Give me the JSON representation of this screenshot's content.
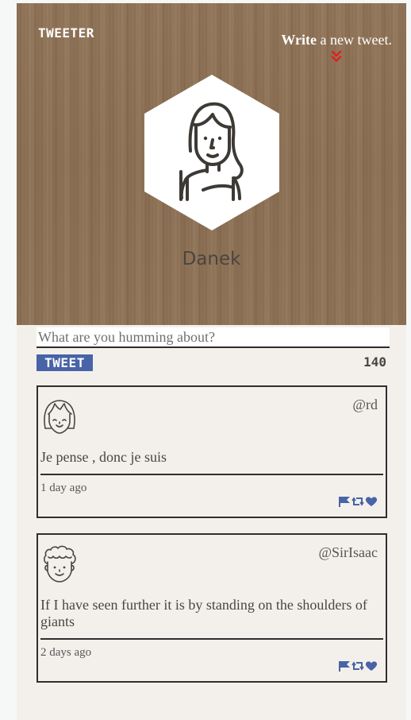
{
  "header": {
    "logo": "TWEETER",
    "write_cta_bold": "Write",
    "write_cta_rest": " a new tweet.",
    "profile_name": "Danek"
  },
  "compose": {
    "placeholder": "What are you humming about?",
    "value": "",
    "tweet_button_label": "TWEET",
    "char_count": "140"
  },
  "tweets": [
    {
      "handle": "@rd",
      "text": "Je pense , donc je suis",
      "time": "1 day ago",
      "avatar": "girl-avatar-icon"
    },
    {
      "handle": "@SirIsaac",
      "text": "If I have seen further it is by standing on the shoulders of giants",
      "time": "2 days ago",
      "avatar": "curly-hair-avatar-icon"
    }
  ],
  "colors": {
    "header_wood": "#8f7356",
    "accent_blue": "#4864a6",
    "chevron_red": "#e02020",
    "panel_bg": "#f3f0ec"
  },
  "icons": {
    "flag": "flag-icon",
    "retweet": "retweet-icon",
    "like": "heart-icon",
    "write": "double-chevron-down-icon"
  }
}
